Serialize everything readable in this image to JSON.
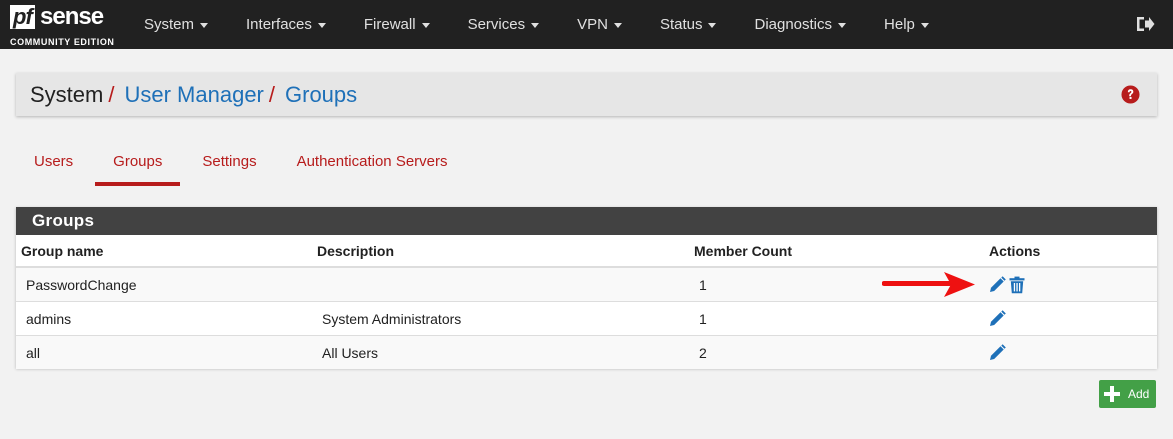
{
  "brand": {
    "logo_pf": "pf",
    "logo_sense": "sense",
    "edition": "COMMUNITY EDITION"
  },
  "nav": {
    "items": [
      "System",
      "Interfaces",
      "Firewall",
      "Services",
      "VPN",
      "Status",
      "Diagnostics",
      "Help"
    ],
    "logout_icon": "sign-out-icon"
  },
  "breadcrumb": {
    "root": "System",
    "sep": "/",
    "items": [
      "User Manager",
      "Groups"
    ],
    "help_icon": "question-circle-icon"
  },
  "tabs": {
    "items": [
      "Users",
      "Groups",
      "Settings",
      "Authentication Servers"
    ],
    "active": "Groups"
  },
  "groups_panel": {
    "title": "Groups",
    "columns": [
      "Group name",
      "Description",
      "Member Count",
      "Actions"
    ],
    "rows": [
      {
        "name": "PasswordChange",
        "description": "",
        "member_count": "1",
        "actions": [
          "pencil-icon",
          "trash-icon"
        ]
      },
      {
        "name": "admins",
        "description": "System Administrators",
        "member_count": "1",
        "actions": [
          "pencil-icon"
        ]
      },
      {
        "name": "all",
        "description": "All Users",
        "member_count": "2",
        "actions": [
          "pencil-icon"
        ]
      }
    ]
  },
  "add_button": {
    "label": "Add",
    "icon": "plus-icon"
  },
  "colors": {
    "navbar": "#212121",
    "accent_red": "#b71c1c",
    "link_blue": "#1e70b8",
    "add_green": "#43a047",
    "panel_heading": "#424242"
  }
}
